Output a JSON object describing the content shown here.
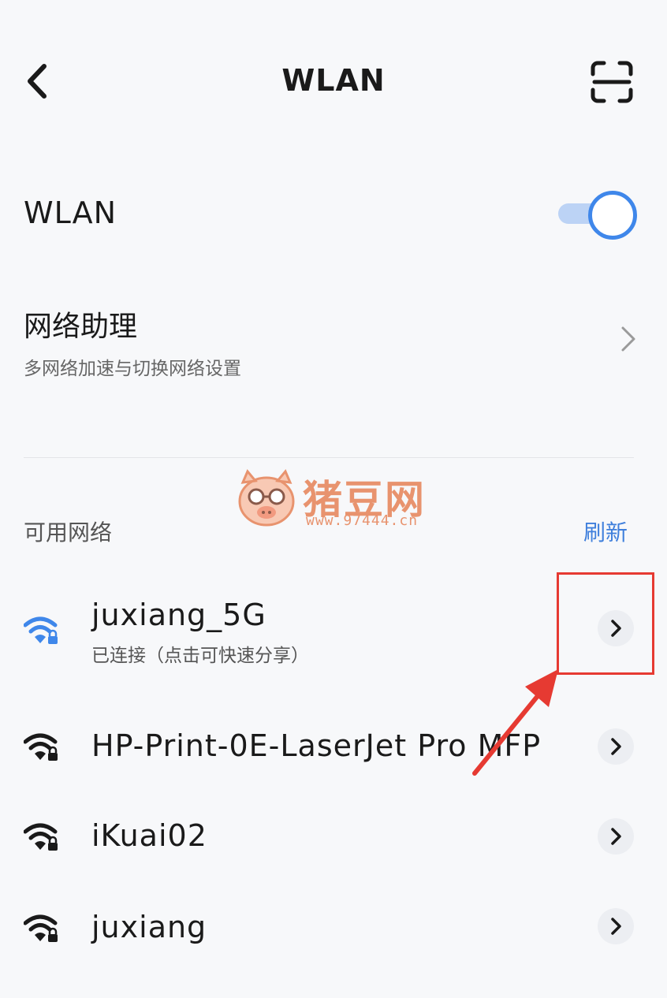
{
  "header": {
    "title": "WLAN",
    "back_icon": "back-chevron-icon",
    "scan_icon": "scan-icon"
  },
  "wlan": {
    "label": "WLAN",
    "enabled": true,
    "accent": "#3f87ea"
  },
  "assistant": {
    "title": "网络助理",
    "subtitle": "多网络加速与切换网络设置"
  },
  "available": {
    "label": "可用网络",
    "refresh_label": "刷新"
  },
  "watermark": {
    "brand": "猪豆网",
    "url": "www.97444.cn"
  },
  "networks": [
    {
      "name": "juxiang_5G",
      "status": "已连接（点击可快速分享）",
      "connected": true,
      "secured": true
    },
    {
      "name": "HP-Print-0E-LaserJet Pro MFP",
      "secured": true
    },
    {
      "name": "iKuai02",
      "secured": true
    },
    {
      "name": "juxiang",
      "secured": true
    }
  ],
  "annotation": {
    "color": "#e63a32"
  }
}
